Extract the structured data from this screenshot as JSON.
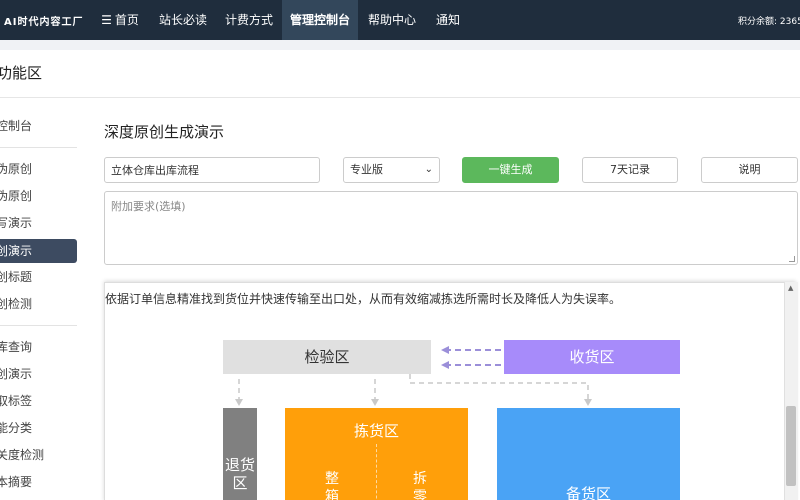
{
  "nav": {
    "brand": "AI时代内容工厂",
    "items": [
      {
        "label": "首页",
        "icon": "list-icon"
      },
      {
        "label": "站长必读"
      },
      {
        "label": "计费方式"
      },
      {
        "label": "管理控制台"
      },
      {
        "label": "帮助中心"
      },
      {
        "label": "通知"
      }
    ],
    "points": "积分余额: 2365"
  },
  "func": {
    "title": "功能区"
  },
  "sidebar": {
    "items": [
      {
        "label": "控制台"
      },
      {
        "label": "伪原创"
      },
      {
        "label": "伪原创"
      },
      {
        "label": "写演示"
      },
      {
        "label": "创演示"
      },
      {
        "label": "创标题"
      },
      {
        "label": "创检测"
      },
      {
        "label": "库查询"
      },
      {
        "label": "创演示"
      },
      {
        "label": "取标签"
      },
      {
        "label": "能分类"
      },
      {
        "label": "关度检测"
      },
      {
        "label": "本摘要"
      }
    ]
  },
  "main": {
    "title": "深度原创生成演示",
    "topic_value": "立体仓库出库流程",
    "version_selected": "专业版",
    "generate_label": "一键生成",
    "history_label": "7天记录",
    "help_label": "说明",
    "extra_placeholder": "附加要求(选填)"
  },
  "doc": {
    "paragraph": "依据订单信息精准找到货位并快速传输至出口处，从而有效缩减拣选所需时长及降低人为失误率。",
    "diagram": {
      "inspect": "检验区",
      "receive": "收货区",
      "return": "退货区",
      "pick": "拣货区",
      "pick_left": "整箱",
      "pick_right": "拆零",
      "stock": "备货区"
    }
  },
  "colors": {
    "topbar": "#1f2d3d",
    "active_sidebar": "#3d4b61",
    "generate_button": "#5cb85c",
    "inspect": "#e0e0e0",
    "receive": "#a78bfa",
    "return": "#808080",
    "pick": "#ff9f0a",
    "stock": "#4aa3f5"
  }
}
